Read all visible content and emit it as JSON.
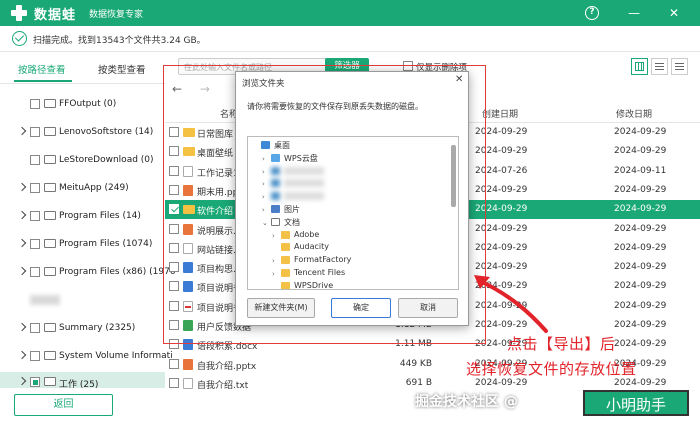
{
  "app": {
    "name": "数据蛙",
    "subtitle": "数据恢复专家",
    "brand_color": "#1aa876"
  },
  "window_controls": {
    "help": "?",
    "minimize": "—",
    "close": "✕"
  },
  "status": {
    "text": "扫描完成。找到13543个文件共3.24 GB。"
  },
  "left_tabs": [
    {
      "label": "按路径查看",
      "active": true
    },
    {
      "label": "按类型查看",
      "active": false
    }
  ],
  "tree": [
    {
      "label": "FFOutput (0)",
      "expandable": false
    },
    {
      "label": "LenovoSoftstore (14)",
      "expandable": true
    },
    {
      "label": "LeStoreDownload (0)",
      "expandable": false
    },
    {
      "label": "MeituApp (249)",
      "expandable": true
    },
    {
      "label": "Program Files (14)",
      "expandable": true
    },
    {
      "label": "Program Files (1074)",
      "expandable": true
    },
    {
      "label": "Program Files (x86) (1976",
      "expandable": true
    },
    {
      "label": "",
      "expandable": false,
      "blurred": true
    },
    {
      "label": "Summary (2325)",
      "expandable": true
    },
    {
      "label": "System Volume Informati",
      "expandable": true
    },
    {
      "label": "工作 (25)",
      "expandable": true,
      "selected": true
    }
  ],
  "back_button": "返回",
  "toolbar": {
    "search_placeholder": "在此处输入文件名或路径",
    "filter_label": "筛选器",
    "deleted_only_label": "仅显示删除项"
  },
  "nav": {
    "back": "←",
    "forward": "→"
  },
  "table": {
    "headers": {
      "name": "名称",
      "size": "大小",
      "created": "创建日期",
      "modified": "修改日期"
    },
    "rows": [
      {
        "name": "日常图库",
        "size": "",
        "created": "2024-09-29",
        "modified": "2024-09-29",
        "icon": "folder-y"
      },
      {
        "name": "桌面壁纸",
        "size": "",
        "created": "2024-09-29",
        "modified": "2024-09-29",
        "icon": "folder-y"
      },
      {
        "name": "工作记录1.",
        "size": "",
        "created": "2024-07-26",
        "modified": "2024-09-11",
        "icon": "txt"
      },
      {
        "name": "期末用.ppt",
        "size": "",
        "created": "2024-09-29",
        "modified": "2024-09-29",
        "icon": "ppt"
      },
      {
        "name": "软件介绍",
        "size": "",
        "created": "2024-09-29",
        "modified": "2024-09-29",
        "icon": "folder-y",
        "selected": true
      },
      {
        "name": "说明展示.p",
        "size": "",
        "created": "2024-09-29",
        "modified": "2024-09-29",
        "icon": "ppt"
      },
      {
        "name": "网站链接.t",
        "size": "",
        "created": "2024-09-29",
        "modified": "2024-09-29",
        "icon": "txt"
      },
      {
        "name": "项目构思.d",
        "size": "",
        "created": "2024-09-29",
        "modified": "2024-09-29",
        "icon": "doc"
      },
      {
        "name": "项目说明书",
        "size": "",
        "created": "2024-09-29",
        "modified": "2024-09-29",
        "icon": "doc"
      },
      {
        "name": "项目说明书",
        "size": "",
        "created": "2024-09-29",
        "modified": "2024-09-29",
        "icon": "red"
      },
      {
        "name": "用户反馈数据",
        "size": "1.12 MB",
        "created": "2024-09-29",
        "modified": "2024-09-29",
        "icon": "green"
      },
      {
        "name": "语段积累.docx",
        "size": "1.11 MB",
        "created": "2024-09-29",
        "modified": "2024-09-29",
        "icon": "doc"
      },
      {
        "name": "自我介绍.pptx",
        "size": "449 KB",
        "created": "2024-09-29",
        "modified": "2024-09-29",
        "icon": "ppt"
      },
      {
        "name": "自我介绍.txt",
        "size": "691 B",
        "created": "2024-09-29",
        "modified": "2024-09-29",
        "icon": "txt"
      }
    ]
  },
  "dialog": {
    "title": "浏览文件夹",
    "close": "✕",
    "message": "请你将需要恢复的文件保存到原丢失数据的磁盘。",
    "nodes": [
      {
        "label": "桌面",
        "indent": 0,
        "icon": "desk",
        "arrow": ""
      },
      {
        "label": "WPS云盘",
        "indent": 1,
        "icon": "cloud",
        "arrow": "›"
      },
      {
        "label": "",
        "indent": 1,
        "icon": "pc",
        "arrow": "›",
        "blurred": true
      },
      {
        "label": "",
        "indent": 1,
        "icon": "pc",
        "arrow": "›",
        "blurred": true
      },
      {
        "label": "",
        "indent": 1,
        "icon": "pc",
        "arrow": "›",
        "blurred": true
      },
      {
        "label": "图片",
        "indent": 1,
        "icon": "pic",
        "arrow": "›"
      },
      {
        "label": "文档",
        "indent": 1,
        "icon": "doc",
        "arrow": "⌄"
      },
      {
        "label": "Adobe",
        "indent": 2,
        "icon": "fold",
        "arrow": "›"
      },
      {
        "label": "Audacity",
        "indent": 2,
        "icon": "fold",
        "arrow": ""
      },
      {
        "label": "FormatFactory",
        "indent": 2,
        "icon": "fold",
        "arrow": "›"
      },
      {
        "label": "Tencent Files",
        "indent": 2,
        "icon": "fold",
        "arrow": "›"
      },
      {
        "label": "WPSDrive",
        "indent": 2,
        "icon": "fold",
        "arrow": ""
      }
    ],
    "new_folder": "新建文件夹(M)",
    "ok": "确定",
    "cancel": "取消"
  },
  "annotation": {
    "line1": "点击【导出】后",
    "line2": "选择恢复文件的存放位置",
    "color": "#e2232a"
  },
  "watermark": "掘金技术社区 @",
  "export_button": "小明助手"
}
